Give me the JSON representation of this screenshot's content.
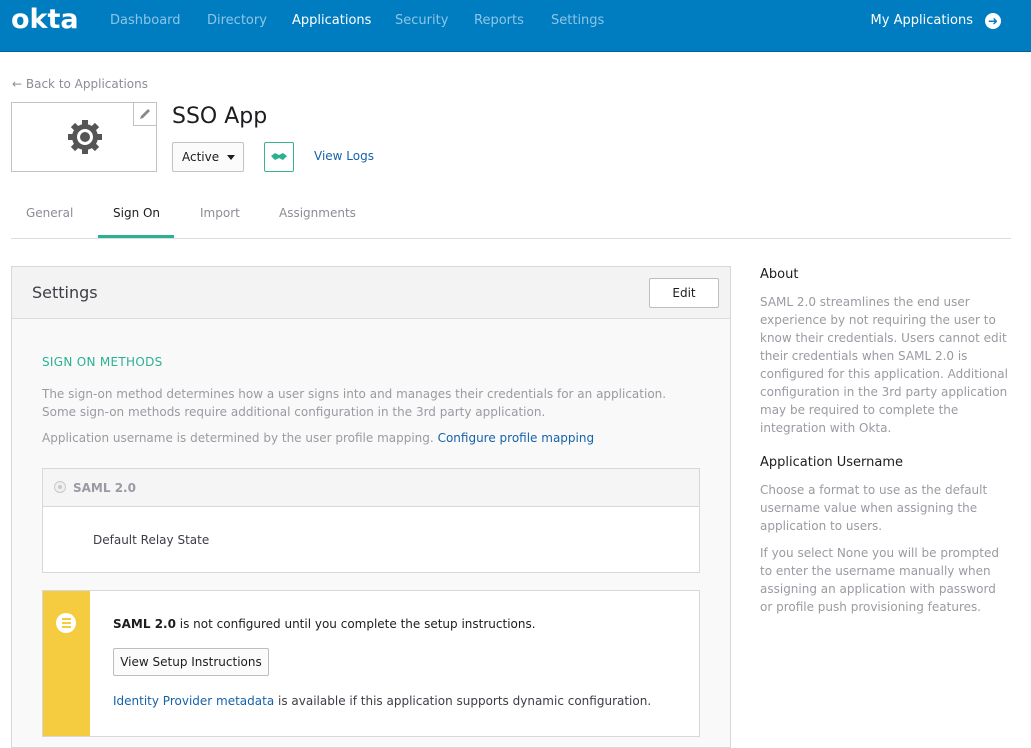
{
  "brand": {
    "logo": "okta",
    "primary_color": "#007dc1",
    "accent_color": "#2ab193",
    "warning_color": "#f5cb40"
  },
  "nav": {
    "items": [
      {
        "label": "Dashboard"
      },
      {
        "label": "Directory"
      },
      {
        "label": "Applications"
      },
      {
        "label": "Security"
      },
      {
        "label": "Reports"
      },
      {
        "label": "Settings"
      }
    ],
    "active": "Applications",
    "my_apps": "My Applications",
    "my_apps_icon": "arrow-right-circle-icon"
  },
  "back_link": "← Back to Applications",
  "app": {
    "title": "SSO App",
    "logo_icon": "gear-icon",
    "status": "Active",
    "status_options": [
      "Active"
    ],
    "view_logs": "View Logs"
  },
  "tabs": [
    {
      "label": "General"
    },
    {
      "label": "Sign On"
    },
    {
      "label": "Import"
    },
    {
      "label": "Assignments"
    }
  ],
  "active_tab": "Sign On",
  "settings": {
    "title": "Settings",
    "edit_label": "Edit",
    "section_title": "SIGN ON METHODS",
    "description": "The sign-on method determines how a user signs into and manages their credentials for an application. Some sign-on methods require additional configuration in the 3rd party application.",
    "username_text": "Application username is determined by the user profile mapping.",
    "username_link": "Configure profile mapping",
    "method": {
      "label": "SAML 2.0",
      "relay_state_label": "Default Relay State"
    },
    "notice": {
      "bold": "SAML 2.0",
      "text": "is not configured until you complete the setup instructions.",
      "button": "View Setup Instructions",
      "metadata_link": "Identity Provider metadata",
      "metadata_text": "is available if this application supports dynamic configuration."
    }
  },
  "sidebar": {
    "about_title": "About",
    "about_text": "SAML 2.0 streamlines the end user experience by not requiring the user to know their credentials. Users cannot edit their credentials when SAML 2.0 is configured for this application. Additional configuration in the 3rd party application may be required to complete the integration with Okta.",
    "username_title": "Application Username",
    "username_text1": "Choose a format to use as the default username value when assigning the application to users.",
    "username_text2": "If you select None you will be prompted to enter the username manually when assigning an application with password or profile push provisioning features."
  }
}
